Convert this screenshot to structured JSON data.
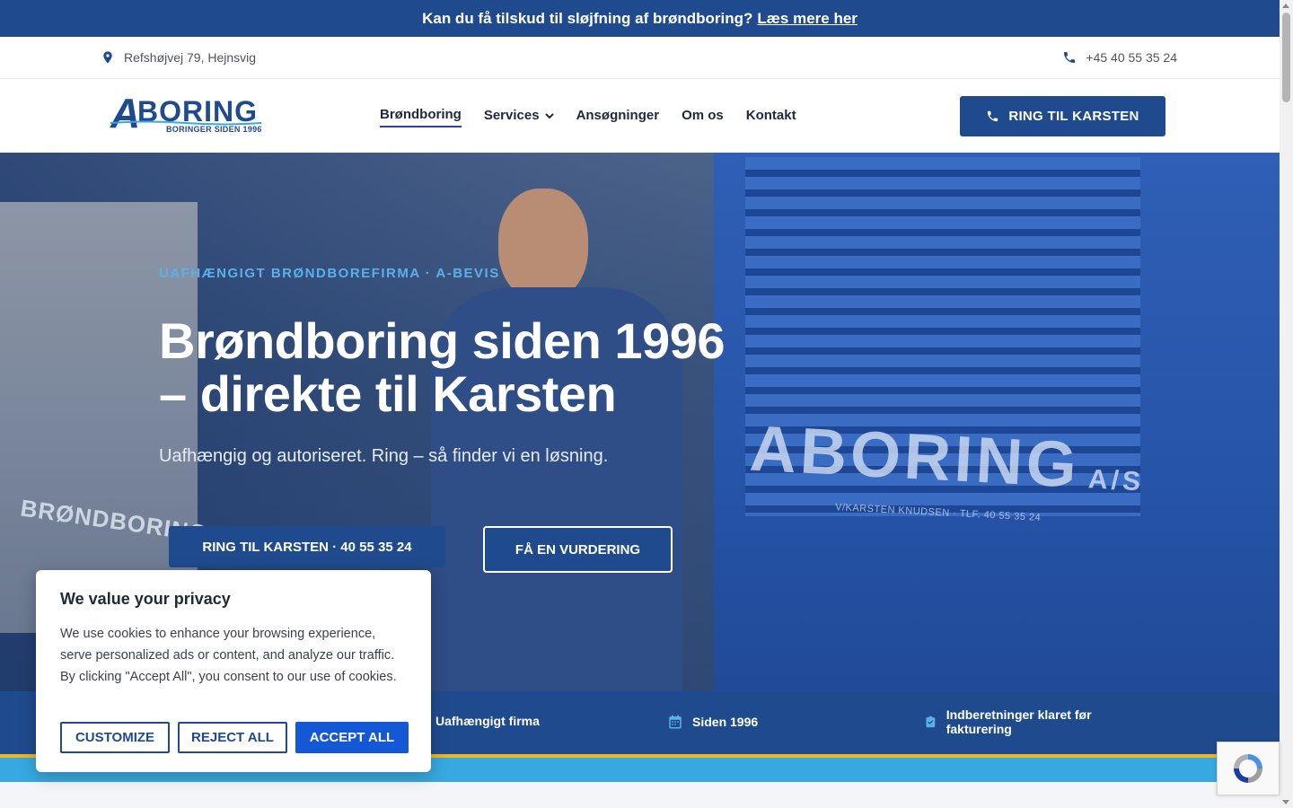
{
  "announcement": {
    "text": "Kan du få tilskud til sløjfning af brøndboring?",
    "link": "Læs mere her"
  },
  "topbar": {
    "address": "Refshøjvej 79, Hejnsvig",
    "phone": "+45 40 55 35 24"
  },
  "logo": {
    "word": "BORING",
    "letter": "A",
    "tagline": "BORINGER SIDEN 1996"
  },
  "nav": {
    "items": [
      {
        "label": "Brøndboring"
      },
      {
        "label": "Services"
      },
      {
        "label": "Ansøgninger"
      },
      {
        "label": "Om os"
      },
      {
        "label": "Kontakt"
      }
    ],
    "cta": "RING TIL KARSTEN"
  },
  "hero": {
    "eyebrow": "UAFHÆNGIGT BRØNDBOREFIRMA · A-BEVIS",
    "title_line1": "Brøndboring siden 1996",
    "title_line2": "– direkte til Karsten",
    "subtitle": "Uafhængig og autoriseret. Ring – så finder vi en løsning.",
    "btn_call": "RING TIL KARSTEN · 40 55 35 24",
    "btn_eval": "FÅ EN VURDERING",
    "machine_word": "BORING",
    "machine_letter": "A",
    "machine_suffix": "A/S",
    "machine_sub": "V/KARSTEN KNUDSEN · TLF. 40 55 35 24",
    "side_text": "BRØNDBORING"
  },
  "features": [
    {
      "label": "Uafhængigt firma",
      "icon": "shield-icon"
    },
    {
      "label": "Siden 1996",
      "icon": "calendar-icon"
    },
    {
      "label": "Indberetninger klaret før fakturering",
      "icon": "clipboard-check-icon"
    }
  ],
  "cookie": {
    "title": "We value your privacy",
    "body": "We use cookies to enhance your browsing experience, serve personalized ads or content, and analyze our traffic. By clicking \"Accept All\", you consent to our use of cookies.",
    "customize": "CUSTOMIZE",
    "reject": "REJECT ALL",
    "accept": "ACCEPT ALL"
  },
  "colors": {
    "brand": "#1f4b8e",
    "accent": "#5ab1ea",
    "stripe_yellow": "#f0b429",
    "stripe_blue": "#37a8e0",
    "accept": "#1558d6"
  }
}
